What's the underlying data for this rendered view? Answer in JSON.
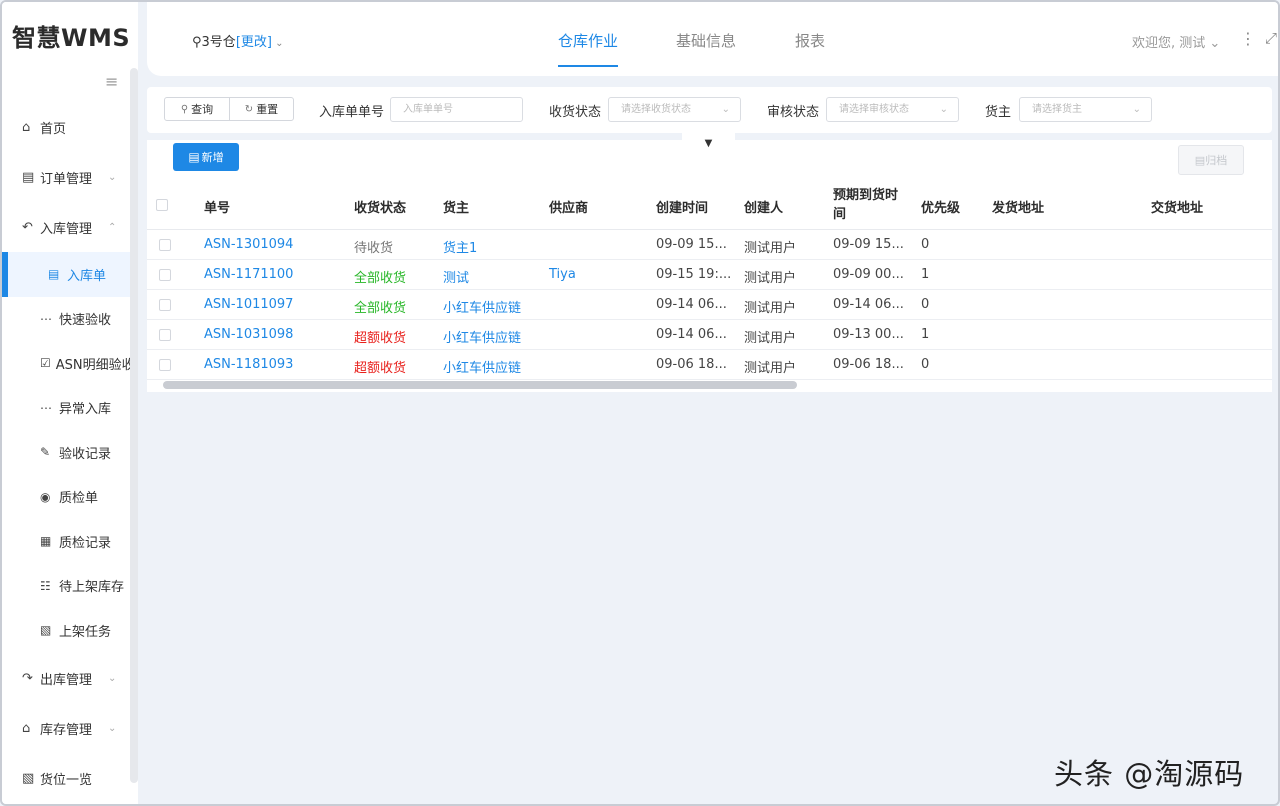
{
  "app": {
    "logo": "智慧WMS"
  },
  "header": {
    "warehouse_prefix": "3号仓",
    "warehouse_change": "[更改]",
    "tabs": [
      {
        "label": "仓库作业",
        "active": true
      },
      {
        "label": "基础信息",
        "active": false
      },
      {
        "label": "报表",
        "active": false
      }
    ],
    "welcome": "欢迎您, 测试"
  },
  "sidebar": {
    "items": [
      {
        "label": "首页",
        "icon": "home-icon"
      },
      {
        "label": "订单管理",
        "icon": "order-icon"
      },
      {
        "label": "入库管理",
        "icon": "inbound-icon"
      },
      {
        "label": "出库管理",
        "icon": "outbound-icon"
      },
      {
        "label": "库存管理",
        "icon": "stock-icon"
      },
      {
        "label": "货位一览",
        "icon": "location-icon"
      }
    ],
    "sub_items": [
      {
        "label": "入库单",
        "icon": "document-icon",
        "active": true
      },
      {
        "label": "快速验收",
        "icon": "ellipsis-circle-icon"
      },
      {
        "label": "ASN明细验收",
        "icon": "check-box-icon"
      },
      {
        "label": "异常入库",
        "icon": "ellipsis-circle-icon"
      },
      {
        "label": "验收记录",
        "icon": "record-icon"
      },
      {
        "label": "质检单",
        "icon": "shield-icon"
      },
      {
        "label": "质检记录",
        "icon": "inspect-record-icon"
      },
      {
        "label": "待上架库存",
        "icon": "boxes-icon"
      },
      {
        "label": "上架任务",
        "icon": "shelf-icon"
      }
    ]
  },
  "filters": {
    "query_label": "查询",
    "reset_label": "重置",
    "asn_label": "入库单单号",
    "asn_placeholder": "入库单单号",
    "receive_label": "收货状态",
    "receive_placeholder": "请选择收货状态",
    "audit_label": "审核状态",
    "audit_placeholder": "请选择审核状态",
    "owner_label": "货主",
    "owner_placeholder": "请选择货主"
  },
  "toolbar": {
    "add_label": "新增",
    "archive_label": "归档"
  },
  "table": {
    "columns": [
      "单号",
      "收货状态",
      "货主",
      "供应商",
      "创建时间",
      "创建人",
      "预期到货时间",
      "优先级",
      "发货地址",
      "交货地址"
    ],
    "rows": [
      {
        "no": "ASN-1301094",
        "status": "待收货",
        "status_type": "pending",
        "owner": "货主1",
        "supplier": "",
        "created": "09-09 15...",
        "creator": "测试用户",
        "expected": "09-09 15...",
        "priority": "0",
        "ship_addr": "",
        "deliver_addr": ""
      },
      {
        "no": "ASN-1171100",
        "status": "全部收货",
        "status_type": "done",
        "owner": "测试",
        "supplier": "Tiya",
        "created": "09-15 19:...",
        "creator": "测试用户",
        "expected": "09-09 00...",
        "priority": "1",
        "ship_addr": "",
        "deliver_addr": ""
      },
      {
        "no": "ASN-1011097",
        "status": "全部收货",
        "status_type": "done",
        "owner": "小红车供应链",
        "supplier": "",
        "created": "09-14 06...",
        "creator": "测试用户",
        "expected": "09-14 06...",
        "priority": "0",
        "ship_addr": "",
        "deliver_addr": ""
      },
      {
        "no": "ASN-1031098",
        "status": "超额收货",
        "status_type": "over",
        "owner": "小红车供应链",
        "supplier": "",
        "created": "09-14 06...",
        "creator": "测试用户",
        "expected": "09-13 00...",
        "priority": "1",
        "ship_addr": "",
        "deliver_addr": ""
      },
      {
        "no": "ASN-1181093",
        "status": "超额收货",
        "status_type": "over",
        "owner": "小红车供应链",
        "supplier": "",
        "created": "09-06 18...",
        "creator": "测试用户",
        "expected": "09-06 18...",
        "priority": "0",
        "ship_addr": "",
        "deliver_addr": ""
      }
    ]
  },
  "colors": {
    "accent": "#1e88e5",
    "done": "#28b728",
    "over": "#e8201c",
    "pending": "#777777"
  },
  "watermark": "头条 @淘源码"
}
